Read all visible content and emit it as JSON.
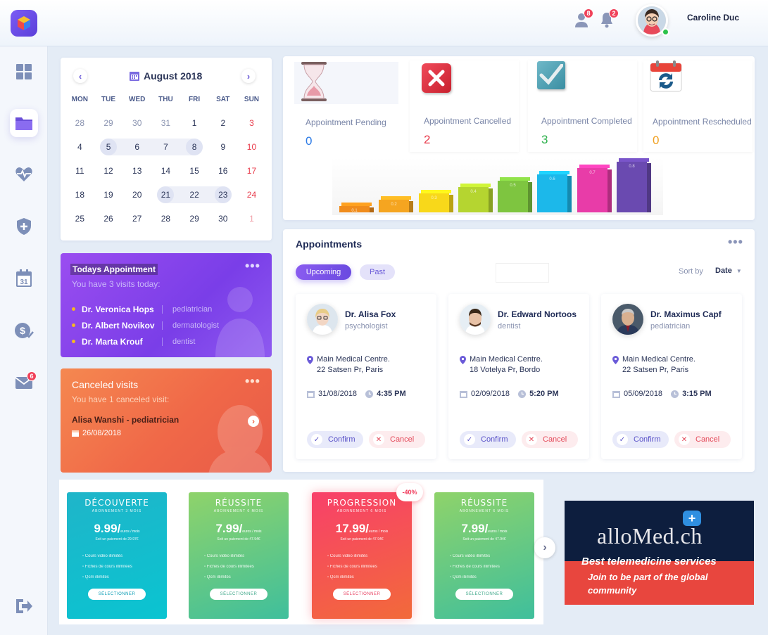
{
  "user": {
    "name": "Caroline Duc",
    "contacts_badge": "8",
    "notifications_badge": "2"
  },
  "sidebar": {
    "mail_badge": "6"
  },
  "calendar": {
    "month": "August 2018",
    "dow": [
      "MON",
      "TUE",
      "WED",
      "THU",
      "FRI",
      "SAT",
      "SUN"
    ],
    "days": [
      [
        "28",
        "29",
        "30",
        "31",
        "1",
        "2",
        "3"
      ],
      [
        "4",
        "5",
        "6",
        "7",
        "8",
        "9",
        "10"
      ],
      [
        "11",
        "12",
        "13",
        "14",
        "15",
        "16",
        "17"
      ],
      [
        "18",
        "19",
        "20",
        "21",
        "22",
        "23",
        "24"
      ],
      [
        "25",
        "26",
        "27",
        "28",
        "29",
        "30",
        "1"
      ]
    ]
  },
  "stats": [
    {
      "label": "Appointment Pending",
      "value": "0",
      "color": "#2d7be6",
      "icon": "hourglass-icon"
    },
    {
      "label": "Appointment Cancelled",
      "value": "2",
      "color": "#e83a4a",
      "icon": "cancel-x-icon"
    },
    {
      "label": "Appointment Completed",
      "value": "3",
      "color": "#2bb04a",
      "icon": "checkmark-icon"
    },
    {
      "label": "Appointment Rescheduled",
      "value": "0",
      "color": "#f0a020",
      "icon": "recycle-icon"
    }
  ],
  "chart_data": {
    "type": "bar",
    "bar_labels": [
      "0.1",
      "0.2",
      "0.3",
      "0.4",
      "0.5",
      "0.6",
      "0.7",
      "0.8"
    ],
    "values": [
      0.1,
      0.2,
      0.3,
      0.4,
      0.5,
      0.6,
      0.7,
      0.8
    ],
    "colors": [
      "#f08c1c",
      "#f5a520",
      "#f8d81a",
      "#b5d530",
      "#7ec540",
      "#1cb8ea",
      "#e83ca8",
      "#6a4ab0"
    ]
  },
  "today": {
    "title": "Todays Appointment",
    "subtitle": "You have 3 visits today:",
    "items": [
      {
        "name": "Dr. Veronica Hops",
        "spec": "pediatrician"
      },
      {
        "name": "Dr. Albert Novikov",
        "spec": "dermatologist"
      },
      {
        "name": "Dr. Marta Krouf",
        "spec": "dentist"
      }
    ]
  },
  "canceled": {
    "title": "Canceled visits",
    "subtitle": "You have 1 canceled visit:",
    "name": "Alisa Wanshi - pediatrician",
    "date": "26/08/2018"
  },
  "appointments": {
    "title": "Appointments",
    "tab_upcoming": "Upcoming",
    "tab_past": "Past",
    "sort_label": "Sort by",
    "sort_value": "Date",
    "confirm": "Confirm",
    "cancel": "Cancel",
    "cards": [
      {
        "name": "Dr. Alisa Fox",
        "spec": "psychologist",
        "addr1": "Main Medical Centre.",
        "addr2": "22 Satsen Pr, Paris",
        "date": "31/08/2018",
        "time": "4:35 PM"
      },
      {
        "name": "Dr. Edward Nortoos",
        "spec": "dentist",
        "addr1": "Main Medical Centre.",
        "addr2": "18 Votelya Pr, Bordo",
        "date": "02/09/2018",
        "time": "5:20 PM"
      },
      {
        "name": "Dr. Maximus Capf",
        "spec": "pediatrician",
        "addr1": "Main Medical Centre.",
        "addr2": "22 Satsen Pr, Paris",
        "date": "05/09/2018",
        "time": "3:15 PM"
      }
    ]
  },
  "plans": [
    {
      "name": "DÉCOUVERTE",
      "sub": "ABONNEMENT 3 MOIS",
      "price": "9.99",
      "unit": "euros / mois",
      "note": "Soit un paiement de 29.97€",
      "features": [
        "Cours vidéo illimités",
        "Fiches de cours illimitées",
        "Qcm illimités"
      ],
      "button": "SÉLECTIONNER",
      "gradient": "linear-gradient(160deg,#1fb5c9,#0ac4d1)"
    },
    {
      "name": "RÉUSSITE",
      "sub": "ABONNEMENT 6 MOIS",
      "price": "7.99",
      "unit": "euros / mois",
      "note": "Soit un paiement de 47.94€",
      "features": [
        "Cours vidéo illimités",
        "Fiches de cours illimitées",
        "Qcm illimités"
      ],
      "button": "SÉLECTIONNER",
      "gradient": "linear-gradient(160deg,#8fd36a,#3fbf9c)"
    },
    {
      "name": "PROGRESSION",
      "sub": "ABONNEMENT 6 MOIS",
      "price": "17.99",
      "unit": "euros / mois",
      "note": "Soit un paiement de 47.94€",
      "features": [
        "Cours vidéo illimités",
        "Fiches de cours illimitées",
        "Qcm illimités"
      ],
      "button": "SÉLECTIONNER",
      "gradient": "linear-gradient(160deg,#f8406a,#f26a3a)",
      "discount": "-40%"
    },
    {
      "name": "RÉUSSITE",
      "sub": "ABONNEMENT 6 MOIS",
      "price": "7.99",
      "unit": "euros / mois",
      "note": "Soit un paiement de 47.94€",
      "features": [
        "Cours vidéo illimités",
        "Fiches de cours illimitées",
        "Qcm illimités"
      ],
      "button": "SÉLECTIONNER",
      "gradient": "linear-gradient(160deg,#8fd36a,#3fbf9c)"
    }
  ],
  "ad": {
    "brand": "alloMed.ch",
    "tagline": "Best telemedicine services",
    "cta1": "Join to be part of the global",
    "cta2": "community"
  }
}
